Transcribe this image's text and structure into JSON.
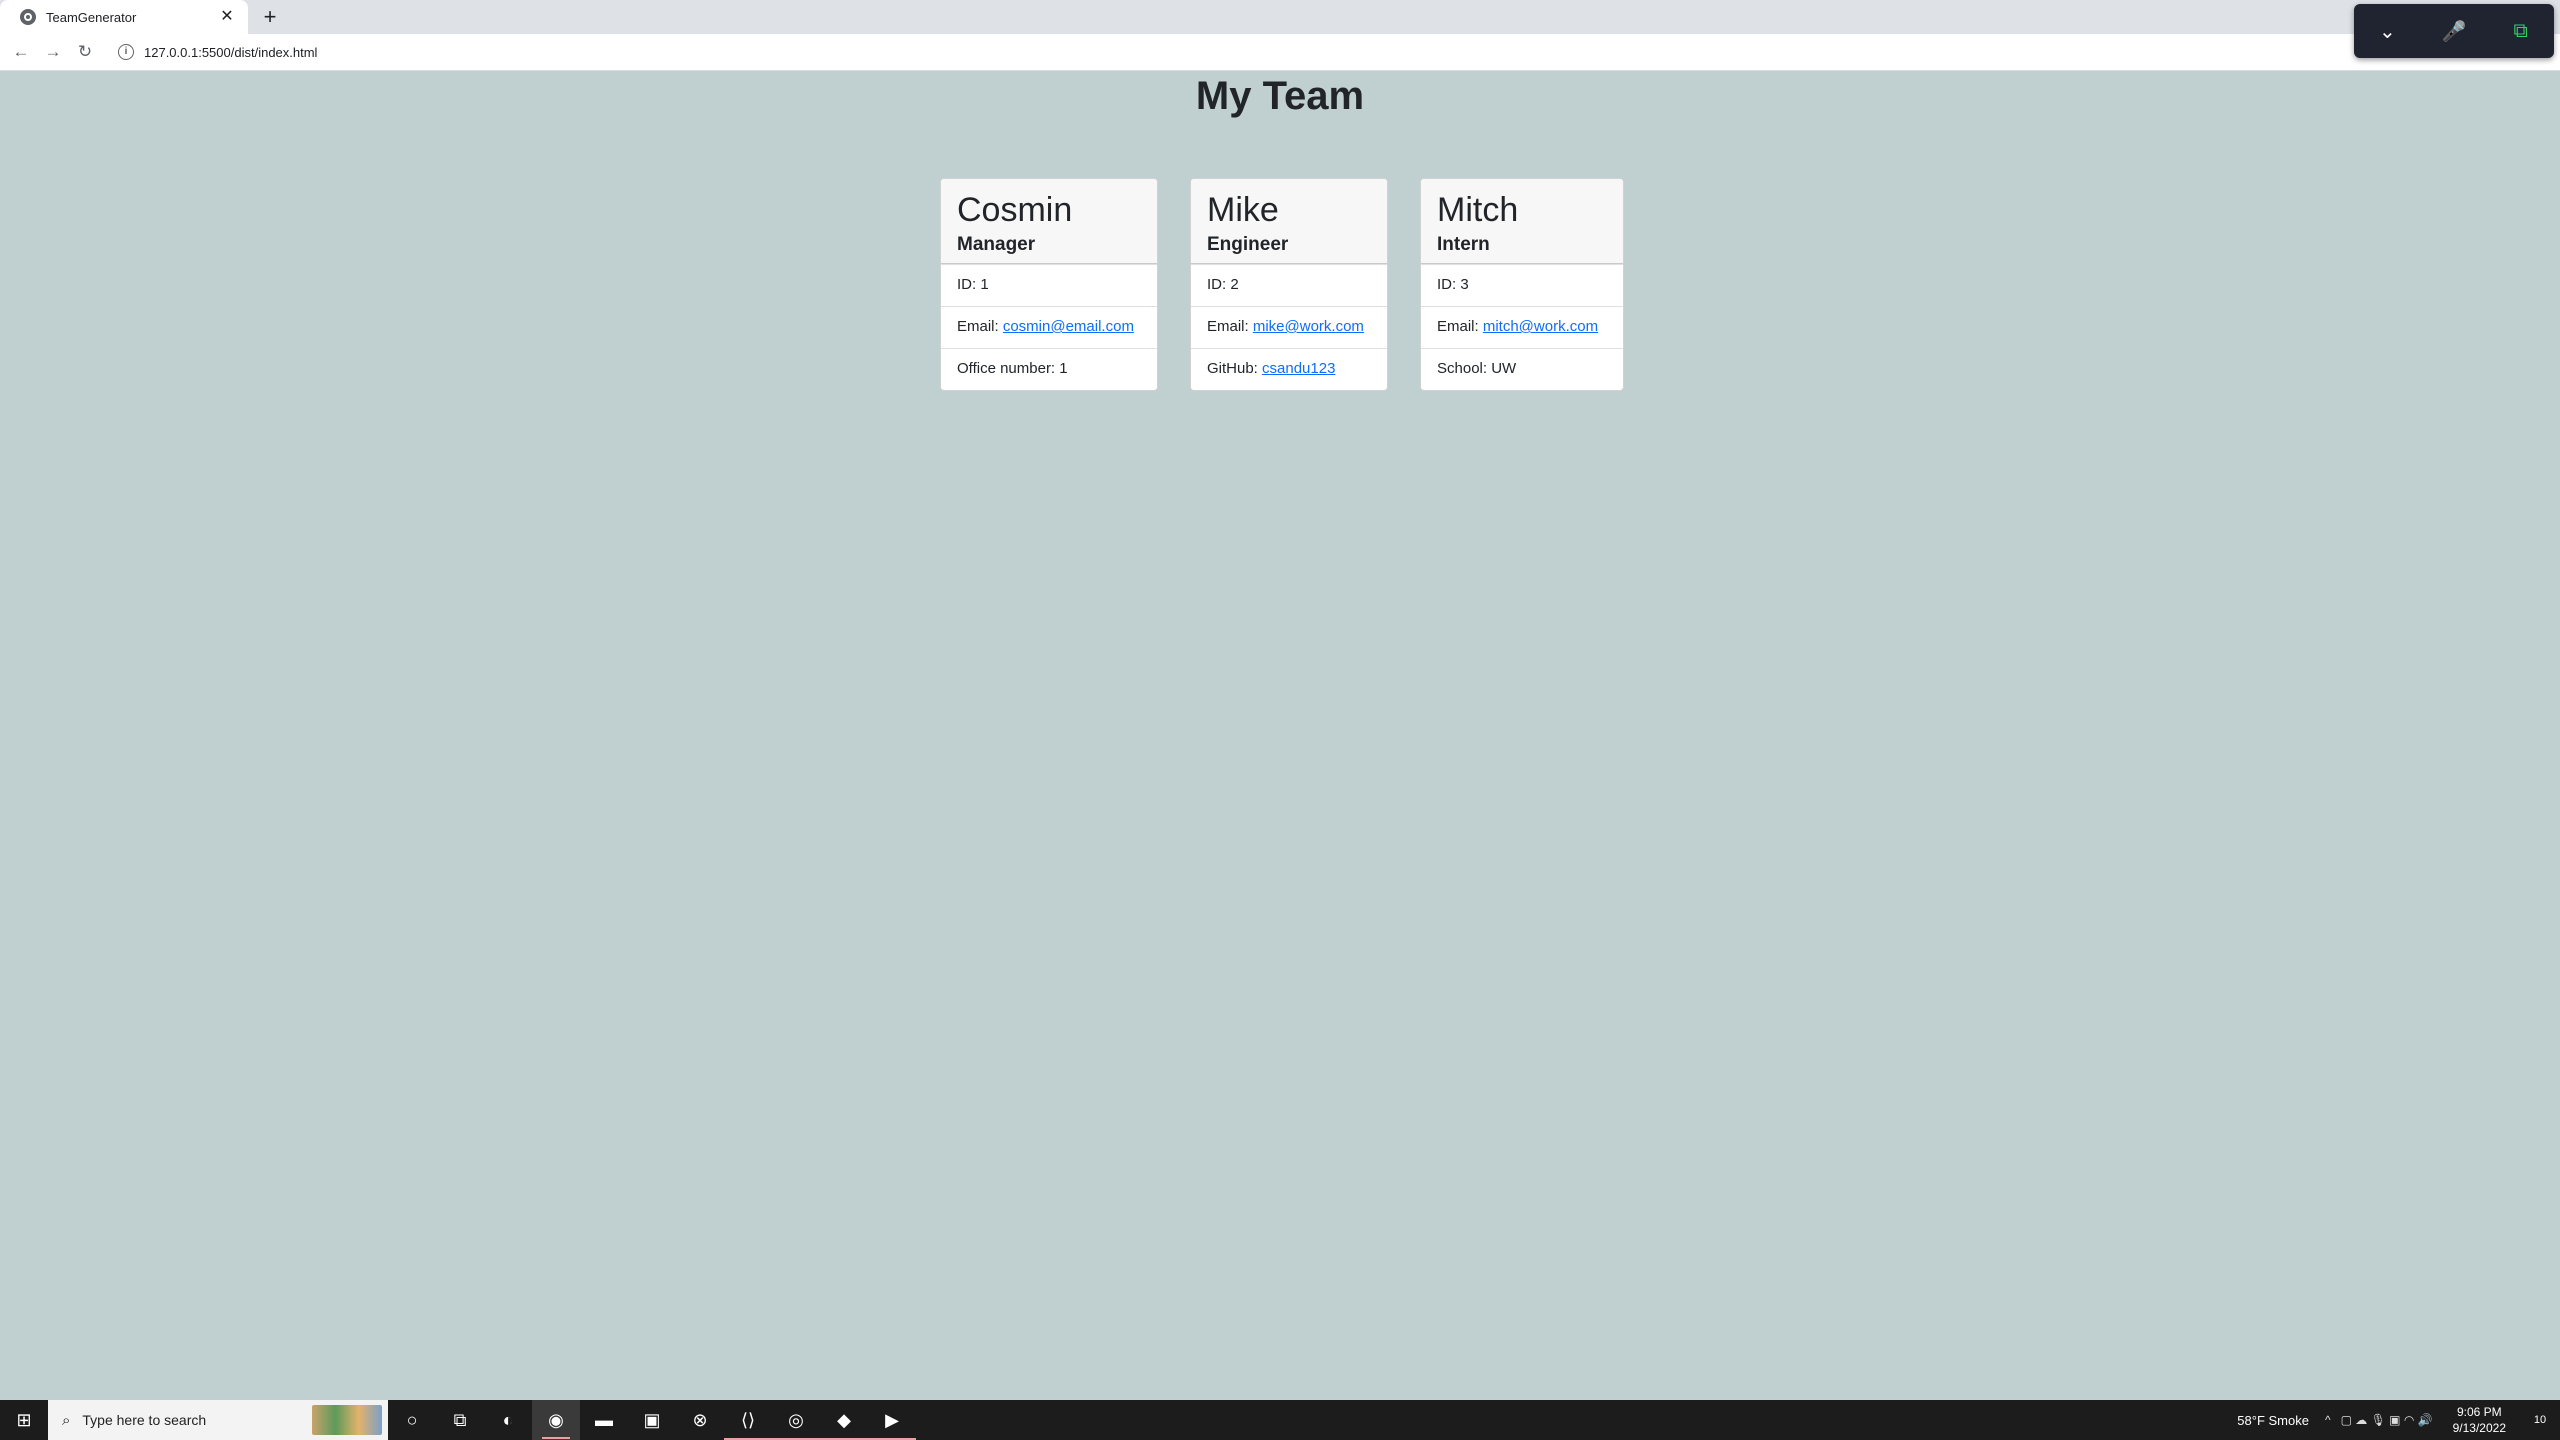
{
  "browser": {
    "tab_title": "TeamGenerator",
    "tab_close": "✕",
    "new_tab": "+",
    "url": "127.0.0.1:5500/dist/index.html",
    "back": "←",
    "forward": "→",
    "reload": "↻",
    "info_icon": "i"
  },
  "overlay": {
    "collapse": "⌄",
    "mic": "🎤",
    "camera": "⧉"
  },
  "page": {
    "title": "My Team",
    "members": [
      {
        "name": "Cosmin",
        "role": "Manager",
        "id_label": "ID: 1",
        "email_label": "Email: ",
        "email": "cosmin@email.com",
        "extra_label": "Office number: 1",
        "extra_link": ""
      },
      {
        "name": "Mike",
        "role": "Engineer",
        "id_label": "ID: 2",
        "email_label": "Email: ",
        "email": "mike@work.com",
        "extra_label": "GitHub: ",
        "extra_link": "csandu123"
      },
      {
        "name": "Mitch",
        "role": "Intern",
        "id_label": "ID: 3",
        "email_label": "Email: ",
        "email": "mitch@work.com",
        "extra_label": "School: UW",
        "extra_link": ""
      }
    ]
  },
  "taskbar": {
    "search_placeholder": "Type here to search",
    "weather": "58°F  Smoke",
    "time": "9:06 PM",
    "date": "9/13/2022",
    "notification_count": "10",
    "start_icon": "⊞",
    "search_icon": "⌕",
    "apps": [
      {
        "name": "cortana-icon",
        "glyph": "○"
      },
      {
        "name": "task-view-icon",
        "glyph": "⧉"
      },
      {
        "name": "edge-icon",
        "glyph": "◐"
      },
      {
        "name": "chrome-icon",
        "glyph": "◉"
      },
      {
        "name": "file-explorer-icon",
        "glyph": "▬"
      },
      {
        "name": "app-icon",
        "glyph": "▣"
      },
      {
        "name": "xbox-icon",
        "glyph": "⊗"
      },
      {
        "name": "vscode-icon",
        "glyph": "⟨⟩"
      },
      {
        "name": "steam-icon",
        "glyph": "◎"
      },
      {
        "name": "git-icon",
        "glyph": "◆"
      },
      {
        "name": "zoom-icon",
        "glyph": "▶"
      }
    ],
    "active_app": 3,
    "underlined_apps": [
      3,
      7,
      8,
      9,
      10
    ]
  },
  "colors": {
    "page_background": "#c0cfcf",
    "link": "#0d6efd",
    "taskbar": "#1c1c1c"
  }
}
